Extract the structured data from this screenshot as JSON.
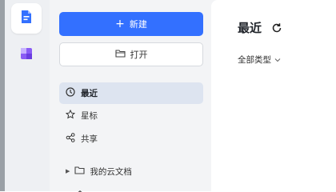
{
  "rail": {
    "items": [
      {
        "icon": "document-icon",
        "color": "#3370ff"
      },
      {
        "icon": "apps-icon",
        "color": "#8a5cf5"
      }
    ]
  },
  "sidebar": {
    "new_button": "新建",
    "open_button": "打开",
    "nav": [
      {
        "label": "最近",
        "icon": "clock-icon",
        "active": true
      },
      {
        "label": "星标",
        "icon": "star-icon",
        "active": false
      },
      {
        "label": "共享",
        "icon": "share-icon",
        "active": false
      }
    ],
    "tree": [
      {
        "label": "我的云文档",
        "icon": "folder-icon"
      }
    ]
  },
  "main": {
    "title": "最近",
    "filter_label": "全部类型"
  },
  "colors": {
    "accent": "#3370ff",
    "active_bg": "#dde4f0"
  }
}
